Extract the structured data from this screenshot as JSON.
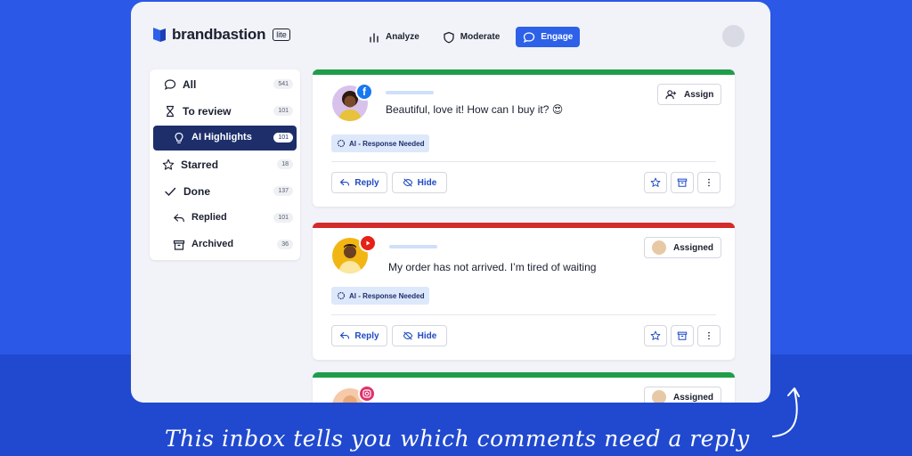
{
  "brand": {
    "name": "brandbastion",
    "badge": "lite"
  },
  "nav": [
    {
      "label": "Analyze",
      "icon": "bar-chart-icon"
    },
    {
      "label": "Moderate",
      "icon": "shield-icon"
    },
    {
      "label": "Engage",
      "icon": "chat-bubble-icon",
      "active": true
    }
  ],
  "sidebar": {
    "items": [
      {
        "label": "All",
        "count": "541",
        "icon": "chat-bubble-icon"
      },
      {
        "label": "To review",
        "count": "101",
        "icon": "hourglass-icon"
      },
      {
        "label": "AI Highlights",
        "count": "101",
        "icon": "lightbulb-icon",
        "active": true
      },
      {
        "label": "Starred",
        "count": "18",
        "icon": "star-icon"
      },
      {
        "label": "Done",
        "count": "137",
        "icon": "check-icon"
      },
      {
        "label": "Replied",
        "count": "101",
        "icon": "reply-icon"
      },
      {
        "label": "Archived",
        "count": "36",
        "icon": "archive-icon"
      }
    ]
  },
  "cards": [
    {
      "platform": "facebook",
      "status_color": "#1f9d4a",
      "comment": "Beautiful, love it! How can I buy it? 😍",
      "tag": "AI - Response Needed",
      "action": "Assign",
      "reply_label": "Reply",
      "hide_label": "Hide"
    },
    {
      "platform": "youtube",
      "status_color": "#d42a2a",
      "comment": "My order has not arrived. I’m tired of waiting",
      "tag": "AI - Response Needed",
      "action": "Assigned",
      "reply_label": "Reply",
      "hide_label": "Hide"
    },
    {
      "platform": "instagram",
      "status_color": "#1f9d4a",
      "action": "Assigned"
    }
  ],
  "caption": "This inbox tells you which comments need a reply",
  "colors": {
    "accent": "#2d61e8",
    "background": "#2b58e6",
    "sidebar_active": "#1d2e6b",
    "facebook": "#1877f2",
    "youtube": "#e62117",
    "instagram": "#e1306c"
  }
}
